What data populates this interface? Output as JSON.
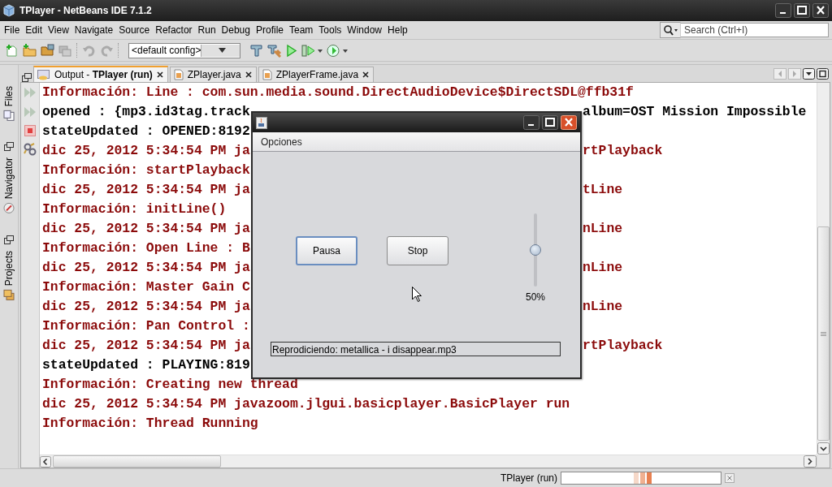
{
  "window": {
    "title": "TPlayer - NetBeans IDE 7.1.2"
  },
  "menu": [
    "File",
    "Edit",
    "View",
    "Navigate",
    "Source",
    "Refactor",
    "Run",
    "Debug",
    "Profile",
    "Team",
    "Tools",
    "Window",
    "Help"
  ],
  "search": {
    "placeholder": "Search (Ctrl+I)"
  },
  "toolbar": {
    "config": "<default config>"
  },
  "side_tabs": [
    "Files",
    "Navigator",
    "Projects"
  ],
  "tabs": [
    {
      "label": "Output - **TPlayer (run)**",
      "selected": true
    },
    {
      "label": "ZPlayer.java",
      "selected": false
    },
    {
      "label": "ZPlayerFrame.java",
      "selected": false
    }
  ],
  "output": {
    "lines": [
      {
        "text": "Información: Line : com.sun.media.sound.DirectAudioDevice$DirectSDL@ffb31f",
        "color": "#8b0a0a"
      },
      {
        "text": "opened : {mp3.id3tag.track",
        "after": "album=OST Mission Impossible",
        "color": "#000000"
      },
      {
        "text": "stateUpdated : OPENED:8192",
        "color": "#000000"
      },
      {
        "text": "dic 25, 2012 5:34:54 PM ja",
        "after": "rtPlayback",
        "color": "#8b0a0a"
      },
      {
        "text": "Información: startPlayback",
        "color": "#8b0a0a"
      },
      {
        "text": "dic 25, 2012 5:34:54 PM ja",
        "after": "tLine",
        "color": "#8b0a0a"
      },
      {
        "text": "Información: initLine()",
        "color": "#8b0a0a"
      },
      {
        "text": "dic 25, 2012 5:34:54 PM ja",
        "after": "nLine",
        "color": "#8b0a0a"
      },
      {
        "text": "Información: Open Line : B",
        "color": "#8b0a0a"
      },
      {
        "text": "dic 25, 2012 5:34:54 PM ja",
        "after": "nLine",
        "color": "#8b0a0a"
      },
      {
        "text": "Información: Master Gain C",
        "color": "#8b0a0a"
      },
      {
        "text": "dic 25, 2012 5:34:54 PM ja",
        "after": "nLine",
        "color": "#8b0a0a"
      },
      {
        "text": "Información: Pan Control :",
        "color": "#8b0a0a"
      },
      {
        "text": "dic 25, 2012 5:34:54 PM ja",
        "after": "rtPlayback",
        "color": "#8b0a0a"
      },
      {
        "text": "stateUpdated : PLAYING:819",
        "color": "#000000"
      },
      {
        "text": "Información: Creating new thread",
        "color": "#8b0a0a"
      },
      {
        "text": "dic 25, 2012 5:34:54 PM javazoom.jlgui.basicplayer.BasicPlayer run",
        "color": "#8b0a0a"
      },
      {
        "text": "Información: Thread Running",
        "color": "#8b0a0a"
      }
    ]
  },
  "dialog": {
    "menu": [
      "Opciones"
    ],
    "buttons": [
      {
        "label": "Pausa",
        "focused": true
      },
      {
        "label": "Stop",
        "focused": false
      }
    ],
    "volume": {
      "level": 0.5,
      "reading": "50%"
    },
    "status": "Reprodiciendo: metallica - i disappear.mp3"
  },
  "status_bar": {
    "task": "TPlayer (run)"
  }
}
